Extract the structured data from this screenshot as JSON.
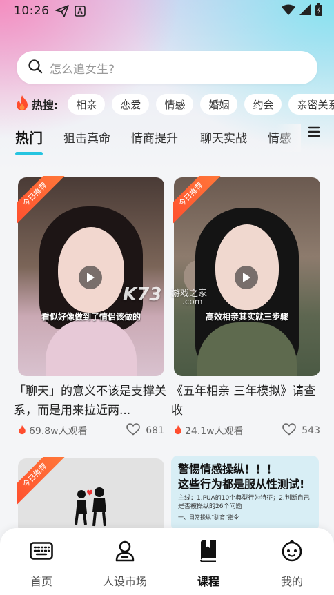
{
  "status_bar": {
    "time": "10:26"
  },
  "search": {
    "placeholder": "怎么追女生?"
  },
  "hot_search": {
    "label": "热搜:",
    "tags": [
      "相亲",
      "恋爱",
      "情感",
      "婚姻",
      "约会",
      "亲密关系"
    ]
  },
  "tabs": [
    "热门",
    "狙击真命",
    "情商提升",
    "聊天实战",
    "情感"
  ],
  "cards": [
    {
      "badge": "今日推荐",
      "caption": "看似好像做到了情侣该做的",
      "title": "「聊天」的意义不该是支撑关系，而是用来拉近两...",
      "views": "69.8w人观看",
      "likes": "681"
    },
    {
      "badge": "今日推荐",
      "caption": "高效相亲其实就三步骤",
      "title": "《五年相亲 三年模拟》请查收",
      "views": "24.1w人观看",
      "likes": "543"
    },
    {
      "badge": "今日推荐"
    },
    {
      "heading_line1": "警惕情感操纵！！！",
      "heading_line2": "这些行为都是服从性测试!",
      "body_line1": "主线：1.PUA的10个典型行为特征；2.判断自己",
      "body_line2": "是否被操纵的26个问题",
      "section": "一、日常操纵“驯育”指令"
    }
  ],
  "watermark": {
    "brand": "K73",
    "site": "游戏之家",
    "url": ".com"
  },
  "bottom_nav": [
    {
      "label": "首页",
      "icon": "keyboard-icon"
    },
    {
      "label": "人设市场",
      "icon": "person-icon"
    },
    {
      "label": "课程",
      "icon": "book-icon",
      "active": true
    },
    {
      "label": "我的",
      "icon": "face-icon"
    }
  ],
  "colors": {
    "accent": "#26c4e0",
    "fire": "#ff4d2e",
    "ribbon": "#ff5a32"
  }
}
